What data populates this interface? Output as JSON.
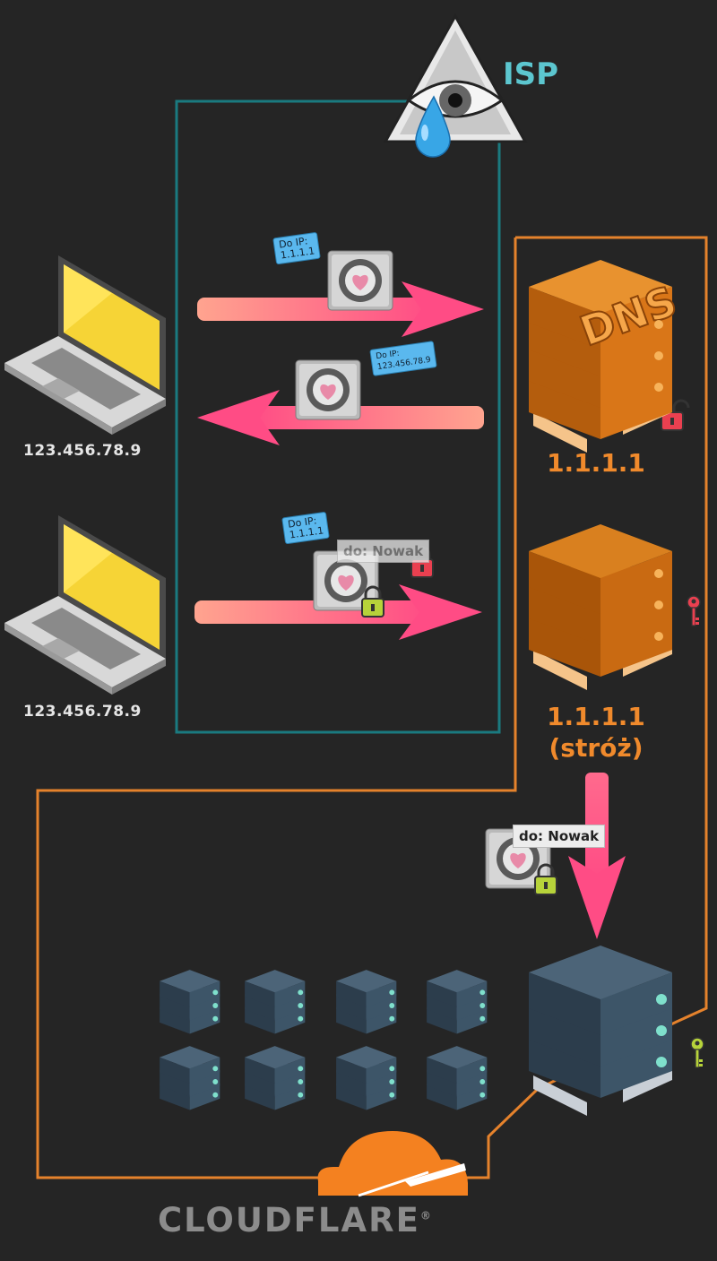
{
  "isp": {
    "label": "ISP"
  },
  "client_top": {
    "ip": "123.456.78.9"
  },
  "client_bottom": {
    "ip": "123.456.78.9"
  },
  "packets": {
    "request_tag": "Do IP:\n1.1.1.1",
    "response_tag": "Do IP:\n123.456.78.9",
    "encrypted_tag": "Do IP:\n1.1.1.1",
    "encrypted_inner": "do: Nowak",
    "forwarded_inner": "do: Nowak"
  },
  "dns_server": {
    "badge": "DNS",
    "ip": "1.1.1.1"
  },
  "guard_server": {
    "ip": "1.1.1.1",
    "role": "(stróż)"
  },
  "cloudflare": {
    "wordmark": "CLOUDFLARE",
    "trademark": "®"
  },
  "colors": {
    "background": "#252525",
    "isp_box": "#1a7a80",
    "cloudflare_border": "#e5822c",
    "server_orange": "#e0801e",
    "server_navy": "#3d5568",
    "arrow_pink": "#ff4f86",
    "arrow_peach": "#ffa090",
    "lock_red": "#e0394a",
    "lock_green": "#b7d33a",
    "tag_blue": "#5ab8ee"
  }
}
